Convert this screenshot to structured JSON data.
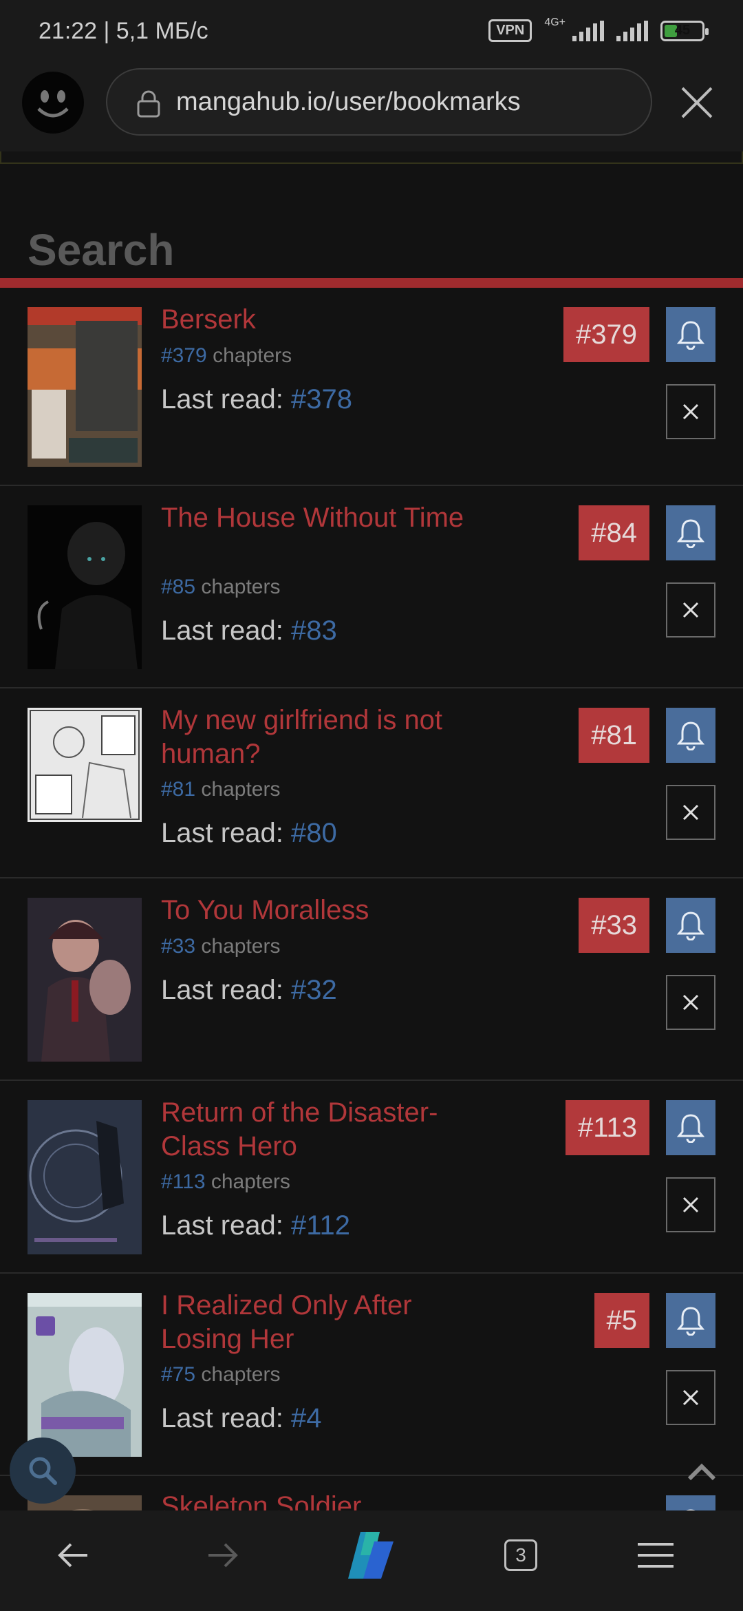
{
  "status": {
    "time": "21:22 | 5,1 МБ/с",
    "vpn": "VPN",
    "network": "4G+",
    "battery": "45"
  },
  "browser": {
    "url": "mangahub.io/user/bookmarks",
    "tabs_count": "3"
  },
  "page": {
    "heading": "Search"
  },
  "colors": {
    "accent_red": "#b2393b",
    "link_blue": "#3d6aa3",
    "bell_blue": "#4a6d9b"
  },
  "bookmarks": [
    {
      "title": "Berserk",
      "chapters_num": "#379",
      "chapters_label": "chapters",
      "last_read_label": "Last read:",
      "last_read": "#378",
      "badge": "#379"
    },
    {
      "title": "The House Without Time",
      "chapters_num": "#85",
      "chapters_label": "chapters",
      "last_read_label": "Last read:",
      "last_read": "#83",
      "badge": "#84"
    },
    {
      "title": "My new girlfriend is not human?",
      "chapters_num": "#81",
      "chapters_label": "chapters",
      "last_read_label": "Last read:",
      "last_read": "#80",
      "badge": "#81"
    },
    {
      "title": "To You Moralless",
      "chapters_num": "#33",
      "chapters_label": "chapters",
      "last_read_label": "Last read:",
      "last_read": "#32",
      "badge": "#33"
    },
    {
      "title": "Return of the Disaster-Class Hero",
      "chapters_num": "#113",
      "chapters_label": "chapters",
      "last_read_label": "Last read:",
      "last_read": "#112",
      "badge": "#113"
    },
    {
      "title": "I Realized Only After Losing Her",
      "chapters_num": "#75",
      "chapters_label": "chapters",
      "last_read_label": "Last read:",
      "last_read": "#4",
      "badge": "#5"
    },
    {
      "title": "Skeleton Soldier"
    }
  ]
}
